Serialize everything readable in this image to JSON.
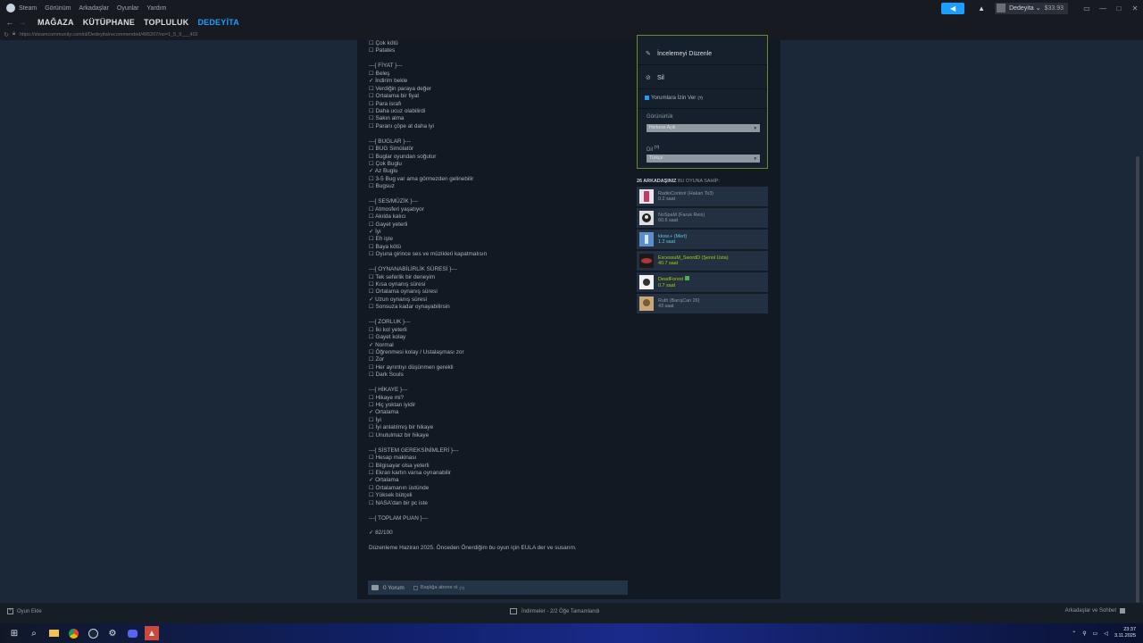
{
  "menu": {
    "items": [
      "Steam",
      "Görünüm",
      "Arkadaşlar",
      "Oyunlar",
      "Yardım"
    ]
  },
  "account": {
    "name": "Dedeyita",
    "balance": "$33.93"
  },
  "nav": {
    "items": [
      "MAĞAZA",
      "KÜTÜPHANE",
      "TOPLULUK",
      "DEDEYİTA"
    ],
    "active": "DEDEYİTA"
  },
  "url": "https://steamcommunity.com/id/Dedeyita/recommended/495207/no=1_5_9___402",
  "review": {
    "lines": [
      "☐ Çok kötü",
      "☐ Patates",
      "",
      "---{ FİYAT }---",
      "☐ Beleş",
      "✓ İndirim bekle",
      "☐ Verdiğin paraya değer",
      "☐ Ortalama bir fiyat",
      "☐ Para israfı",
      "☐ Daha ucuz olabilirdi",
      "☐ Sakın alma",
      "☐ Paranı çöpe at daha iyi",
      "",
      "---{ BUGLAR }---",
      "☐ BUG Simülatör",
      "☐ Buglar oyundan soğutur",
      "☐ Çok Buglu",
      "✓ Az Buglu",
      "☐ 3-5 Bug var ama görmezden gelinebilir",
      "☐ Bugsuz",
      "",
      "---{ SES/MÜZİK }---",
      "☐ Atmosferi yaşatıyor",
      "☐ Akılda kalıcı",
      "☐ Gayet yeterli",
      "✓ İyi",
      "☐ Eh işte",
      "☐ Baya kötü",
      "☐ Oyuna girince ses ve müzikleri kapatmalısın",
      "",
      "---{ OYNANABİLİRLİK SÜRESİ }---",
      "☐ Tek seferlik bir deneyim",
      "☐ Kısa oynanış süresi",
      "☐ Ortalama oynanış süresi",
      "✓ Uzun oynanış süresi",
      "☐ Sonsuza kadar oynayabilirsin",
      "",
      "---{ ZORLUK }---",
      "☐ İki kol yeterli",
      "☐ Gayet kolay",
      "✓ Normal",
      "☐ Öğrenmesi kolay / Ustalaşması zor",
      "☐ Zor",
      "☐ Her ayrıntıyı düşünmen gerekli",
      "☐ Dark Souls",
      "",
      "---{ HİKAYE }---",
      "☐ Hikaye mi?",
      "☐ Hiç yoktan iyidir",
      "✓ Ortalama",
      "☐ İyi",
      "☐ İyi anlatılmış bir hikaye",
      "☐ Unutulmaz bir hikaye",
      "",
      "---{ SİSTEM GEREKSİNİMLERİ }---",
      "☐ Hesap makinası",
      "☐ Bilgisayar olsa yeterli",
      "☐ Ekran kartın varsa oynanabilir",
      "✓ Ortalama",
      "☐ Ortalamanın üstünde",
      "☐ Yüksek bütçeli",
      "☐ NASA'dan bir pc iste",
      "",
      "---{ TOPLAM PUAN }---",
      "",
      "✓ 82/100",
      "",
      "Düzenleme Haziran 2025. Önceden Önerdiğim bu oyun için EULA der ve susarım."
    ]
  },
  "comments": {
    "count_label": "0 Yorum",
    "subscribe_label": "Başlığa abone ol",
    "help": "(?)"
  },
  "owner_panel": {
    "edit_label": "İncelemeyi Düzenle",
    "delete_label": "Sil",
    "allow_comments_label": "Yorumlara İzin Ver",
    "help": "(?)",
    "visibility_label": "Görünürlük",
    "visibility_value": "Herkese Açık",
    "language_label": "Dil",
    "language_value": "Türkçe"
  },
  "friends": {
    "count_label": "26 ARKADAŞINIZ",
    "suffix_label": "BU OYUNA SAHİP:",
    "list": [
      {
        "name": "RadioControl (Hakan Ts3)",
        "hours": "0.2 saat",
        "status": "off"
      },
      {
        "name": "NoSpaM (Faruk Reis)",
        "hours": "60.6 saat",
        "status": "off"
      },
      {
        "name": "kksw.+ (Mert)",
        "hours": "1.2 saat",
        "status": "on"
      },
      {
        "name": "ExcessuM_SwordD (Şenol Usta)",
        "hours": "40.7 saat",
        "status": "game"
      },
      {
        "name": "DeadForest",
        "hours": "0.7 saat",
        "status": "game"
      },
      {
        "name": "Ruth (BarışCan 26)",
        "hours": "43 saat",
        "status": "off"
      }
    ]
  },
  "status": {
    "add_game": "Oyun Ekle",
    "downloads": "İndirmeler - 2/2 Öğe Tamamlandı",
    "friends_chat": "Arkadaşlar ve Sohbet"
  },
  "taskbar": {
    "time": "23:37",
    "date": "3.11.2025"
  },
  "colors": {
    "accent": "#1a9fff",
    "online": "#57cbde",
    "in_game": "#a3cf06"
  }
}
